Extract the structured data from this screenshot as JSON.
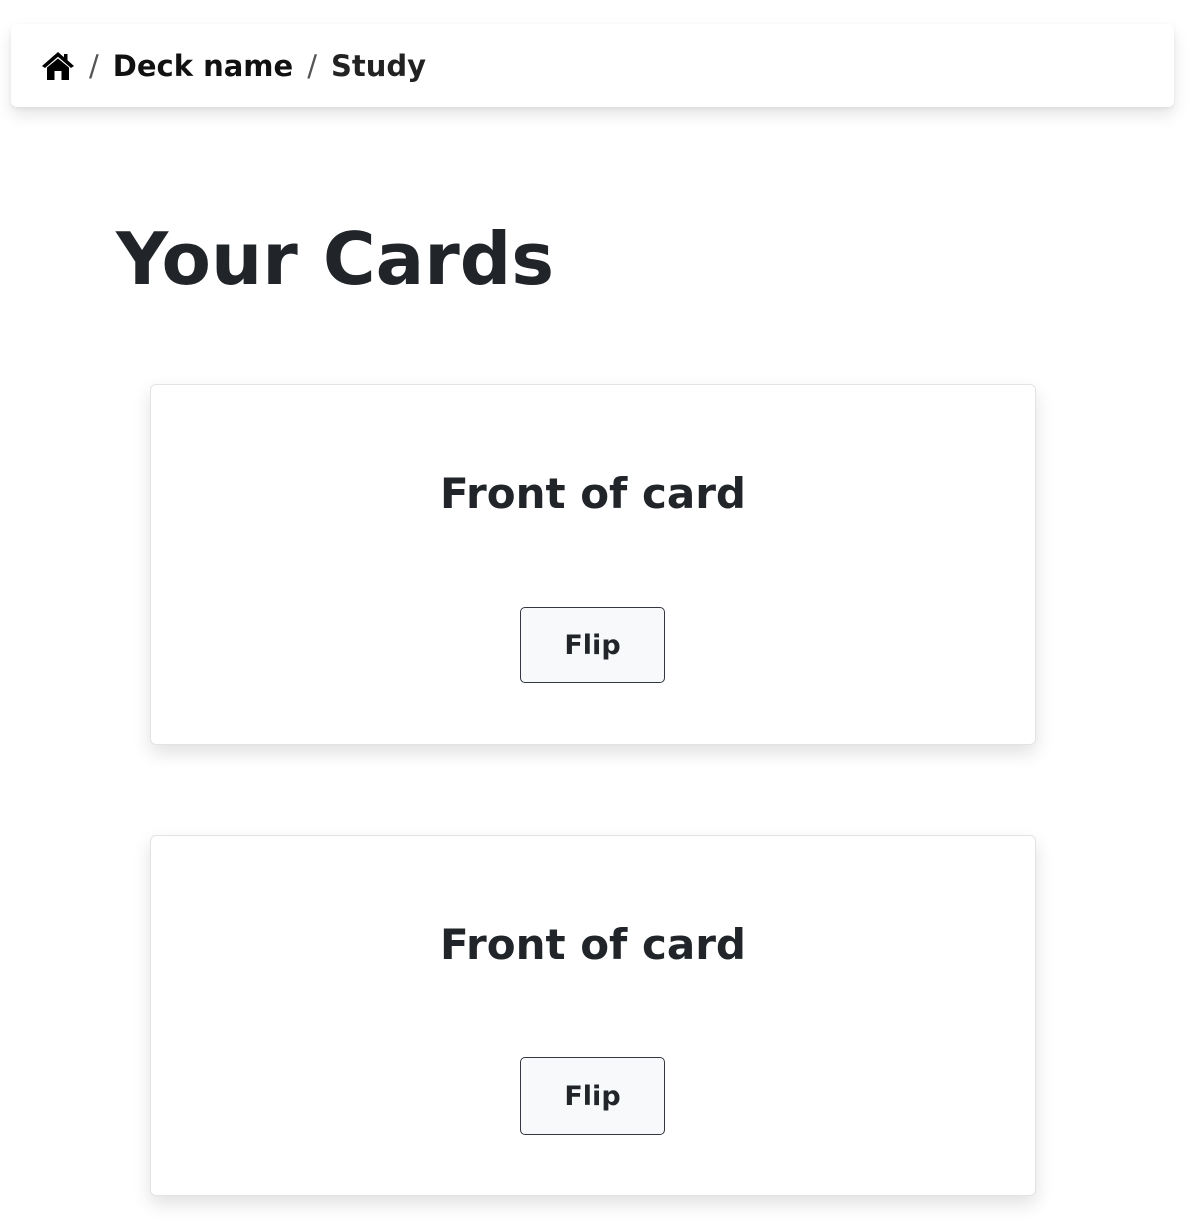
{
  "breadcrumb": {
    "home_icon": "home-icon",
    "separator": "/",
    "deck": "Deck name",
    "current": "Study"
  },
  "page": {
    "title": "Your Cards"
  },
  "cards": [
    {
      "front": "Front of card",
      "flip_label": "Flip"
    },
    {
      "front": "Front of card",
      "flip_label": "Flip"
    }
  ],
  "colors": {
    "text": "#212529",
    "button_bg": "#f8f9fa",
    "button_border": "#333840",
    "card_border": "#e3e3e3"
  }
}
